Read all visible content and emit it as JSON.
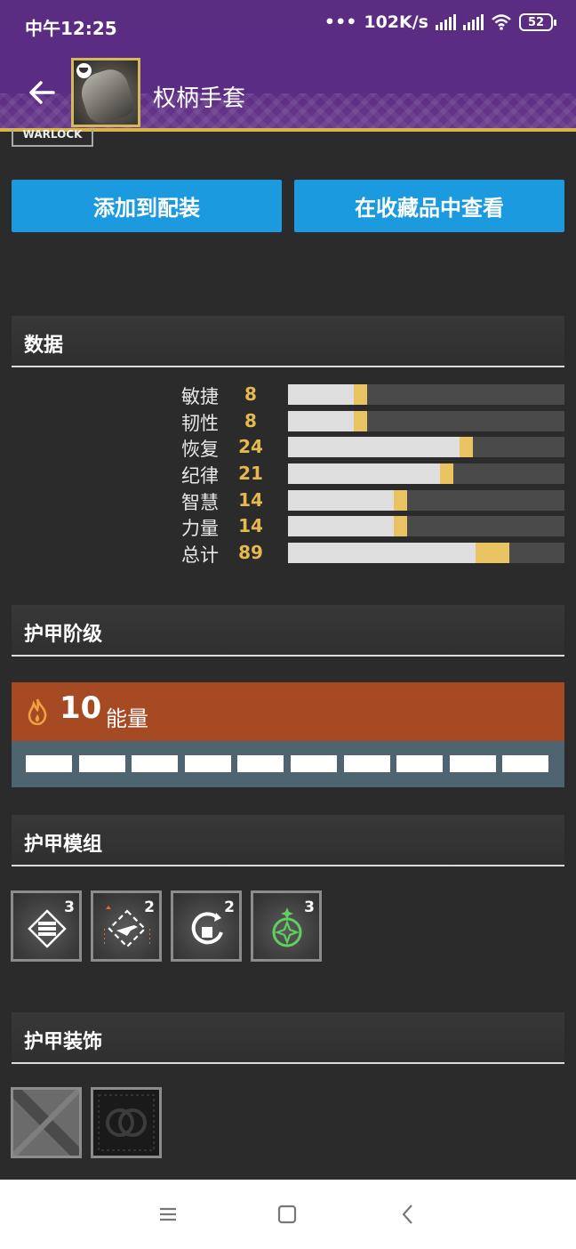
{
  "status_bar": {
    "time": "中午12:25",
    "speed": "102K/s",
    "battery": "52"
  },
  "header": {
    "title": "权柄手套",
    "class_tag": "WARLOCK"
  },
  "actions": {
    "add_to_loadout": "添加到配装",
    "view_in_collections": "在收藏品中查看"
  },
  "stats": {
    "title": "数据",
    "max": 42,
    "rows": [
      {
        "name": "敏捷",
        "value": "8"
      },
      {
        "name": "韧性",
        "value": "8"
      },
      {
        "name": "恢复",
        "value": "24"
      },
      {
        "name": "纪律",
        "value": "21"
      },
      {
        "name": "智慧",
        "value": "14"
      },
      {
        "name": "力量",
        "value": "14"
      },
      {
        "name": "总计",
        "value": "89"
      }
    ]
  },
  "armor_tier": {
    "title": "护甲阶级",
    "energy": "10",
    "energy_label": "能量",
    "capacity": 10
  },
  "armor_mods": {
    "title": "护甲模组",
    "mods": [
      {
        "icon": "ammo-finder-icon",
        "cost": "3"
      },
      {
        "icon": "weapon-targeting-icon",
        "cost": "2"
      },
      {
        "icon": "grenade-loader-icon",
        "cost": "2"
      },
      {
        "icon": "strand-siphon-icon",
        "cost": "3"
      }
    ]
  },
  "armor_ornaments": {
    "title": "护甲装饰"
  },
  "colors": {
    "accent": "#1b9ae0",
    "stat_value": "#e5b94e",
    "energy": "#a64a23",
    "header": "#5a2d82"
  }
}
